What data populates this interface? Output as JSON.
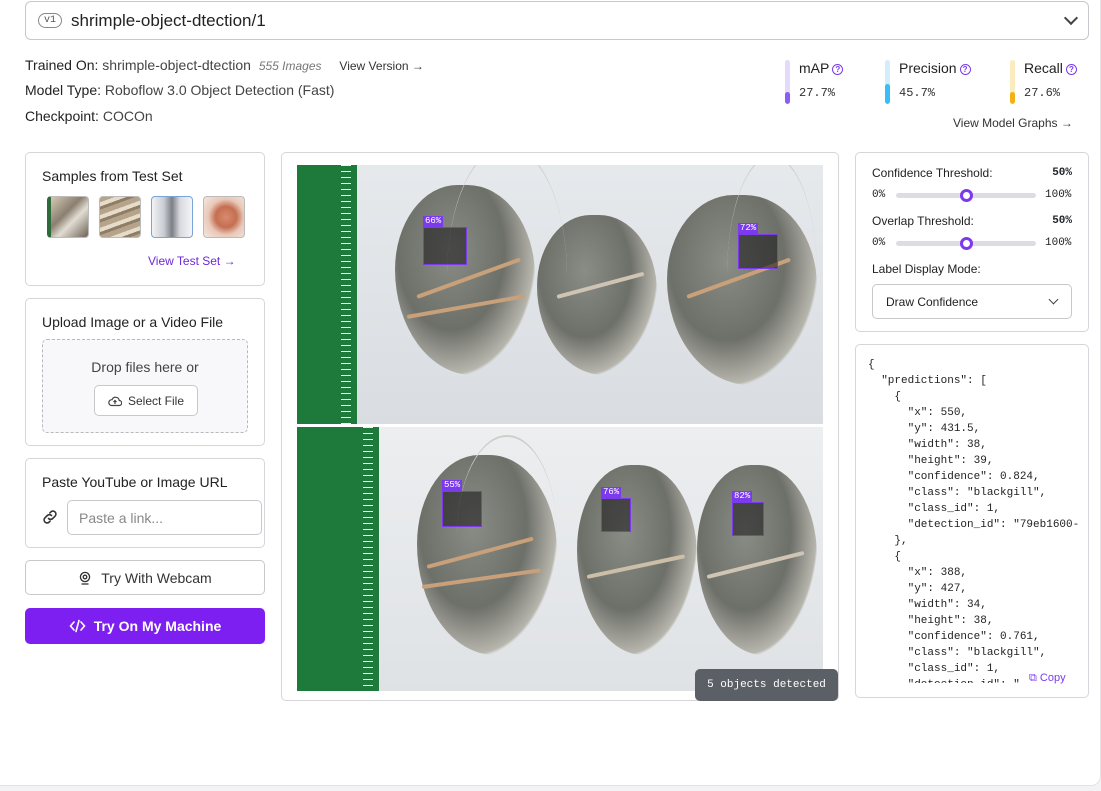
{
  "version": {
    "badge": "v1",
    "name": "shrimple-object-dtection/1"
  },
  "meta": {
    "trained_on_label": "Trained On:",
    "trained_on_value": "shrimple-object-dtection",
    "images": "555 Images",
    "view_version": "View Version →",
    "model_type_label": "Model Type:",
    "model_type_value": "Roboflow 3.0 Object Detection (Fast)",
    "checkpoint_label": "Checkpoint:",
    "checkpoint_value": "COCOn"
  },
  "metrics": [
    {
      "label": "mAP",
      "value": "27.7%",
      "level": 0.277,
      "color": "#8b5cf6",
      "track": "#e4dbfb"
    },
    {
      "label": "Precision",
      "value": "45.7%",
      "level": 0.457,
      "color": "#38bdf8",
      "track": "#d2eefb"
    },
    {
      "label": "Recall",
      "value": "27.6%",
      "level": 0.276,
      "color": "#f5b015",
      "track": "#fbecc0"
    }
  ],
  "view_model_graphs": "View Model Graphs →",
  "samples": {
    "title": "Samples from Test Set",
    "link": "View Test Set →"
  },
  "upload": {
    "title": "Upload Image or a Video File",
    "drop_text": "Drop files here or",
    "select_label": "Select File"
  },
  "url": {
    "title": "Paste YouTube or Image URL",
    "placeholder": "Paste a link..."
  },
  "webcam_label": "Try With Webcam",
  "machine_label": "Try On My Machine",
  "detections": [
    {
      "label": "66%"
    },
    {
      "label": "72%"
    },
    {
      "label": "55%"
    },
    {
      "label": "76%"
    },
    {
      "label": "82%"
    }
  ],
  "detected_text": "5 objects detected",
  "settings": {
    "confidence_label": "Confidence Threshold:",
    "confidence_value": "50%",
    "confidence_level": 0.5,
    "overlap_label": "Overlap Threshold:",
    "overlap_value": "50%",
    "overlap_level": 0.5,
    "min": "0%",
    "max": "100%",
    "label_mode_label": "Label Display Mode:",
    "label_mode_value": "Draw Confidence"
  },
  "json_output": "{\n  \"predictions\": [\n    {\n      \"x\": 550,\n      \"y\": 431.5,\n      \"width\": 38,\n      \"height\": 39,\n      \"confidence\": 0.824,\n      \"class\": \"blackgill\",\n      \"class_id\": 1,\n      \"detection_id\": \"79eb1600-\n    },\n    {\n      \"x\": 388,\n      \"y\": 427,\n      \"width\": 34,\n      \"height\": 38,\n      \"confidence\": 0.761,\n      \"class\": \"blackgill\",\n      \"class_id\": 1,\n      \"detection_id\": \"",
  "copy_label": "Copy"
}
